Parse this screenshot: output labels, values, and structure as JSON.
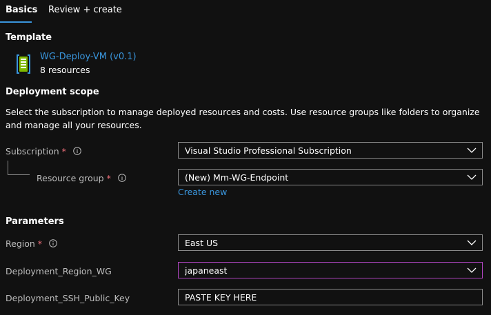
{
  "tabs": [
    {
      "label": "Basics",
      "active": true
    },
    {
      "label": "Review + create",
      "active": false
    }
  ],
  "template": {
    "heading": "Template",
    "icon": "template-icon",
    "name": "WG-Deploy-VM (v0.1)",
    "resources": "8 resources"
  },
  "deployment_scope": {
    "heading": "Deployment scope",
    "description": "Select the subscription to manage deployed resources and costs. Use resource groups like folders to organize and manage all your resources.",
    "subscription": {
      "label": "Subscription",
      "required": "*",
      "value": "Visual Studio Professional Subscription"
    },
    "resource_group": {
      "label": "Resource group",
      "required": "*",
      "value": "(New) Mm-WG-Endpoint",
      "create_new": "Create new"
    }
  },
  "parameters": {
    "heading": "Parameters",
    "region": {
      "label": "Region",
      "required": "*",
      "value": "East US"
    },
    "deployment_region_wg": {
      "label": "Deployment_Region_WG",
      "value": "japaneast"
    },
    "deployment_ssh_public_key": {
      "label": "Deployment_SSH_Public_Key",
      "value": "PASTE KEY HERE"
    }
  },
  "colors": {
    "background": "#111111",
    "accent": "#3a96dd",
    "required": "#f1707b",
    "focus_border": "#b146c2",
    "field_border": "#8a8a8a"
  }
}
